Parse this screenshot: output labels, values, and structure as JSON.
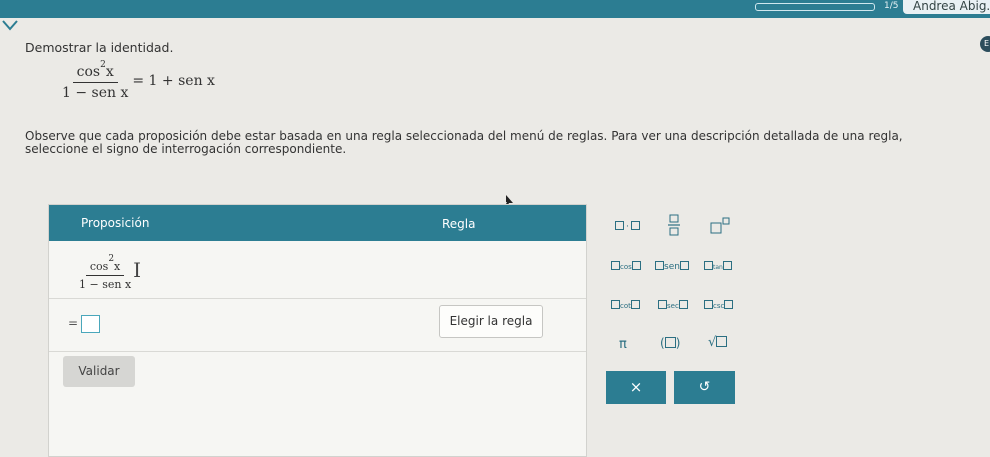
{
  "topbar": {
    "progress_count": "1/5",
    "user_name": "Andrea Abig..."
  },
  "side_badge": "E",
  "problem": {
    "title": "Demostrar la identidad.",
    "formula": {
      "num_base": "cos",
      "num_exp": "2",
      "num_var": "x",
      "den": "1 − sen x",
      "rhs": "= 1 + sen x"
    },
    "instructions": "Observe que cada proposición debe estar basada en una regla seleccionada del menú de reglas. Para ver una descripción detallada de una regla, seleccione el signo de interrogación correspondiente."
  },
  "table": {
    "col_proposition": "Proposición",
    "col_rule": "Regla",
    "row1": {
      "num_base": "cos",
      "num_exp": "2",
      "num_var": "x",
      "den": "1 − sen x"
    },
    "row2": {
      "eq": "=",
      "rule_button": "Elegir la regla"
    },
    "validate_button": "Validar"
  },
  "keypad": {
    "dot": "·",
    "fn_cos": "cos",
    "fn_sen": "sen",
    "fn_tan": "tan",
    "fn_cot": "cot",
    "fn_sec": "sec",
    "fn_csc": "csc",
    "pi": "π",
    "paren_open": "(",
    "paren_close": ")",
    "sqrt": "√",
    "clear": "×",
    "undo": "↺"
  },
  "colors": {
    "accent": "#2c7d92",
    "background": "#ebeae6",
    "key_text": "#2b6f82"
  }
}
